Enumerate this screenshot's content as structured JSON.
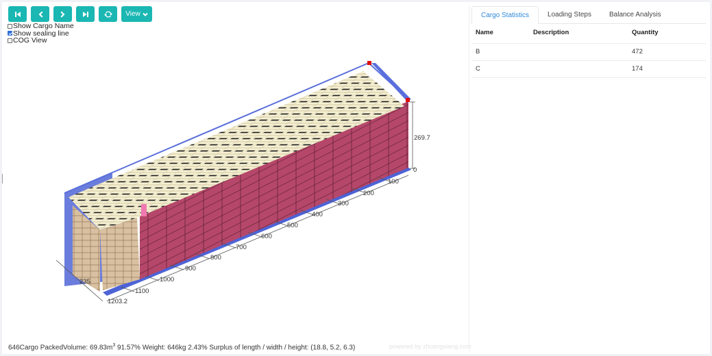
{
  "toolbar": {
    "buttons": [
      "first-step",
      "previous-step",
      "next-step",
      "last-step",
      "refresh"
    ],
    "view_label": "View"
  },
  "options": {
    "show_cargo_name": {
      "label": "Show Cargo Name",
      "checked": false
    },
    "show_sealing_line": {
      "label": "Show sealing line",
      "checked": true
    },
    "cog_view": {
      "label": "COG View",
      "checked": false
    }
  },
  "dimensions": {
    "height_label": "269.7",
    "height_zero": "0",
    "width_label": "235",
    "length_total": "1203.2",
    "length_ticks": [
      "100",
      "200",
      "300",
      "400",
      "500",
      "600",
      "700",
      "800",
      "900",
      "1000",
      "1100"
    ]
  },
  "status": {
    "prefix": "646Cargo PackedVolume: 69.83m",
    "superscript": "3",
    "suffix": " 91.57% Weight: 646kg 2.43% Surplus of length / width / height: (18.8, 5.2, 6.3)"
  },
  "powered_by": "powered by zhuangxiang.com",
  "sidebar": {
    "tabs": [
      "Cargo Statistics",
      "Loading Steps",
      "Balance Analysis"
    ],
    "active_tab": 0,
    "table": {
      "headers": [
        "Name",
        "Description",
        "Quantity"
      ],
      "rows": [
        {
          "name": "B",
          "description": "",
          "quantity": "472"
        },
        {
          "name": "C",
          "description": "",
          "quantity": "174"
        }
      ]
    }
  },
  "colors": {
    "accent": "#1bb7b3",
    "container_blue": "#5b6fd8",
    "cargo_b_top": "#f6f1d2",
    "cargo_b_side": "#d8c0a0",
    "cargo_c_side": "#b5476a",
    "active_tab": "#2e88d8"
  }
}
